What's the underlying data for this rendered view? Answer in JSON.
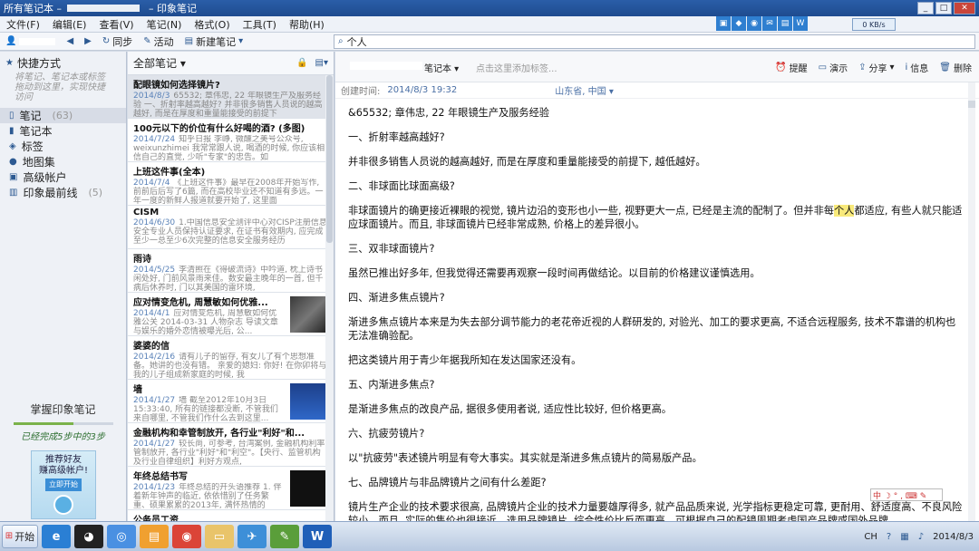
{
  "window": {
    "title_prefix": "所有笔记本 –",
    "title_app": "– 印象笔记",
    "controls": {
      "minimize": "_",
      "maximize": "□",
      "close": "✕"
    }
  },
  "menu": [
    "文件(F)",
    "编辑(E)",
    "查看(V)",
    "笔记(N)",
    "格式(O)",
    "工具(T)",
    "帮助(H)"
  ],
  "toolbar": {
    "sync": "同步",
    "activity": "活动",
    "new_note": "新建笔记",
    "search_value": "个人"
  },
  "network_speed": "0 KB/s",
  "sidebar": {
    "shortcuts_title": "快捷方式",
    "shortcuts_hint": "将笔记、笔记本或标签拖动到这里，实现快捷访问",
    "items": [
      {
        "label": "笔记",
        "count": "(63)",
        "icon": "note-icon"
      },
      {
        "label": "笔记本",
        "count": "",
        "icon": "notebook-icon"
      },
      {
        "label": "标签",
        "count": "",
        "icon": "tag-icon"
      },
      {
        "label": "地图集",
        "count": "",
        "icon": "map-pin-icon"
      },
      {
        "label": "高级帐户",
        "count": "",
        "icon": "premium-icon"
      },
      {
        "label": "印象最前线",
        "count": "(5)",
        "icon": "feed-icon"
      }
    ],
    "promo_title": "掌握印象笔记",
    "promo_subtitle": "已经完成5步中的3步",
    "promo_progress": 0.6,
    "ad_line1": "推荐好友",
    "ad_line2": "赚高级帐户!",
    "ad_button": "立即开始"
  },
  "note_list": {
    "header": "全部笔记",
    "notes": [
      {
        "title": "配眼镜如何选择镜片?",
        "date": "2014/8/3",
        "snippet": "65532; 章伟忠, 22 年眼镜生产及服务经验 一、折射率越高越好? 并非很多销售人员说的越高越好, 而是在厚度和重量能接受的前提下",
        "thumb": ""
      },
      {
        "title": "100元以下的价位有什么好喝的酒? (多图)",
        "date": "2014/7/24",
        "snippet": "知乎日报 李峥, 微醺之美号公众号, weixunzhimei 我常常跟人说, 喝酒的时候, 你应该相信自己的直觉, 少听\"专家\"的忠告。如",
        "thumb": ""
      },
      {
        "title": "上班这件事(全本)",
        "date": "2014/7/4",
        "snippet": "《上班这件事》最早在2008年开始写作, 前前后后写了6篇, 而在高校毕业还不知道有多远。一年一度的新鲜人报道就要开始了, 这里面",
        "thumb": ""
      },
      {
        "title": "CISM",
        "date": "2014/6/30",
        "snippet": "1.中国信息安全测评中心对CISP注册信息安全专业人员保持认证要求, 在证书有效期内, 应完成至少一总至少6次完整的信息安全服务经历",
        "thumb": ""
      },
      {
        "title": "雨诗",
        "date": "2014/5/25",
        "snippet": "李清照在《得破流诗》中吟道, 枕上诗书闲处好, 门前风景雨来佳。数安最主晚年的一首, 但千病后休养时, 门以其美国的雷环境,",
        "thumb": ""
      },
      {
        "title": "应对情变危机, 周慧敏如何优雅...",
        "date": "2014/4/1",
        "snippet": "应对情变危机, 周慧敏如何优雅公关 2014-03-31 人物杂志 导读文章与娱乐的婚外恋情被曝光后, 公...",
        "thumb": "photo"
      },
      {
        "title": "婆婆的信",
        "date": "2014/2/16",
        "snippet": "请有儿子的留存, 有女儿了有个思想准备。她讲的也没有错。 亲爱的媳妇: 你好! 在你卯将与我的儿子组成新家庭的时候, 我",
        "thumb": ""
      },
      {
        "title": "墙",
        "date": "2014/1/27",
        "snippet": "墙 截至2012年10月3日 15:33:40, 所有的链接都没断, 不管我们来自哪里, 不管我们作什么去到这里...",
        "thumb": "screen"
      },
      {
        "title": "金融机构和幸管制放开, 各行业\"利好\"和...",
        "date": "2014/1/27",
        "snippet": "较长尚, 可参考, 台湾案例, 金融机构利率管制放开, 各行业\"利好\"和\"利空\"。【央行、监管机构及行业自律组织】利好方观点,",
        "thumb": ""
      },
      {
        "title": "年终总结书写",
        "date": "2014/1/23",
        "snippet": "年终总结的开头语推荐 1. 伴着新年钟声的临近, 依依惜别了任务繁重、硕果累累的2013年, 满怀热情的",
        "thumb": "book"
      },
      {
        "title": "公务员工资",
        "date": "2014/1/18",
        "snippet": "《人民日报》今天(2月)发表了一篇文",
        "thumb": ""
      }
    ]
  },
  "editor": {
    "notebook": "笔记本",
    "tag_placeholder": "点击这里添加标签...",
    "actions": [
      "提醒",
      "演示",
      "分享",
      "信息",
      "删除"
    ],
    "created_label": "创建时间:",
    "created_value": "2014/8/3 19:32",
    "location": "山东省, 中国",
    "paragraphs": [
      "&65532; 章伟忠, 22 年眼镜生产及服务经验",
      "一、折射率越高越好?",
      "并非很多销售人员说的越高越好, 而是在厚度和重量能接受的前提下, 越低越好。",
      "二、非球面比球面高级?",
      "非球面镜片的确更接近裸眼的视觉, 镜片边沿的变形也小一些, 视野更大一点, 已经是主流的配制了。但并非每",
      "三、双非球面镜片?",
      "虽然已推出好多年, 但我觉得还需要再观察一段时间再做结论。以目前的价格建议谨慎选用。",
      "四、渐进多焦点镜片?",
      "渐进多焦点镜片本来是为失去部分调节能力的老花帝近视的人群研发的, 对验光、加工的要求更高, 不适合远程服务, 技术不靠谱的机构也无法准确验配。",
      "把这类镜片用于青少年据我所知在发达国家还没有。",
      "五、内渐进多焦点?",
      "是渐进多焦点的改良产品, 据很多使用者说, 适应性比较好, 但价格更高。",
      "六、抗疲劳镜片?",
      "以\"抗疲劳\"表述镜片明显有夸大事实。其实就是渐进多焦点镜片的简易版产品。",
      "七、品牌镜片与非品牌镜片之间有什么差距?",
      "镜片生产企业的技术要求很高, 品牌镜片企业的技术力量要雄厚得多, 就产品品质来说, 光学指标更稳定可靠, 更耐用、舒适度高、不良风险较小。而且, 实际的售价也很接近。选用品牌镜片, 综合性价比反而更高。可根据自己的配镜周期考虑国产品牌或国外品牌。"
    ],
    "p5_highlight": "个人",
    "p5_rest": "都适应, 有些人就只能适应球面镜片。而且, 非球面镜片已经非常成熟, 价格上的差异很小。"
  },
  "ime_bar": "中 ☽ ° , ⌨ ✎",
  "taskbar": {
    "start": "开始",
    "lang": "CH",
    "date": "2014/8/3"
  }
}
